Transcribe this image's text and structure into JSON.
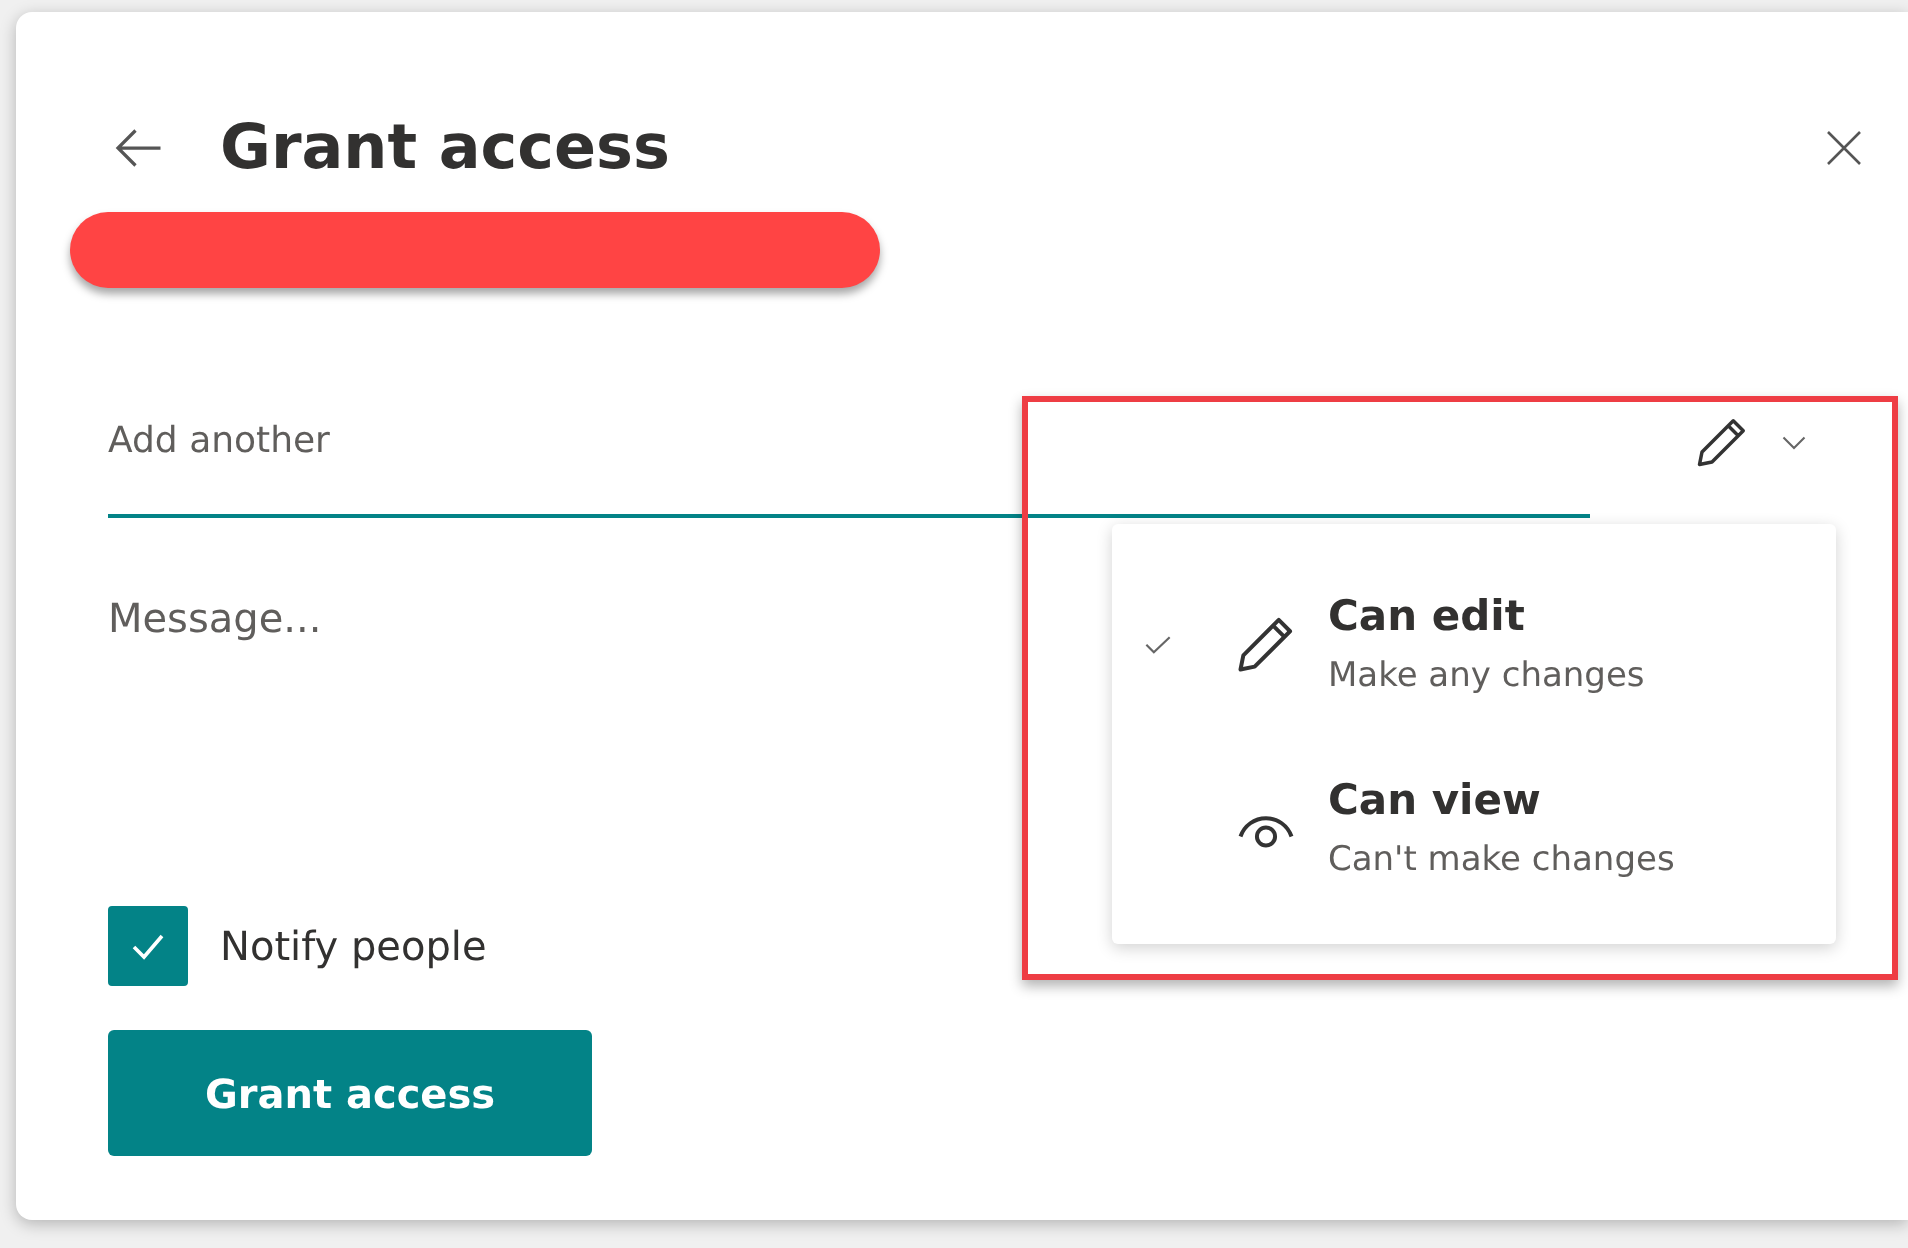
{
  "dialog": {
    "title": "Grant access",
    "recipient_field": {
      "placeholder": "Add another"
    },
    "permission_menu": {
      "expanded": true,
      "items": [
        {
          "kind": "edit",
          "title": "Can edit",
          "description": "Make any changes",
          "selected": true
        },
        {
          "kind": "view",
          "title": "Can view",
          "description": "Can't make changes",
          "selected": false
        }
      ]
    },
    "message_field": {
      "placeholder": "Message..."
    },
    "notify": {
      "label": "Notify people",
      "checked": true
    },
    "submit_button": "Grant access"
  }
}
